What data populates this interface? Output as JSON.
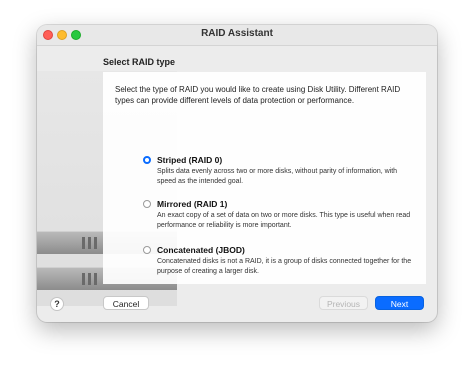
{
  "window": {
    "title": "RAID Assistant"
  },
  "section_title": "Select RAID type",
  "intro": "Select the type of RAID you would like to create using Disk Utility. Different RAID types can provide different levels of data protection or performance.",
  "options": [
    {
      "label": "Striped (RAID 0)",
      "description": "Splits data evenly across two or more disks, without parity of information, with speed as the intended goal.",
      "selected": true
    },
    {
      "label": "Mirrored (RAID 1)",
      "description": "An exact copy of a set of data on two or more disks. This type is useful when read performance or reliability is more important.",
      "selected": false
    },
    {
      "label": "Concatenated (JBOD)",
      "description": "Concatenated disks is not a RAID, it is a group of disks connected together for the purpose of creating a larger disk.",
      "selected": false
    }
  ],
  "footer": {
    "help_label": "?",
    "cancel_label": "Cancel",
    "previous_label": "Previous",
    "next_label": "Next"
  },
  "colors": {
    "accent": "#0a6cff",
    "close": "#ff5f57",
    "minimize": "#febc2e",
    "maximize": "#28c840"
  },
  "icons": {
    "drive_illustration": "hard-drive-enclosure"
  }
}
